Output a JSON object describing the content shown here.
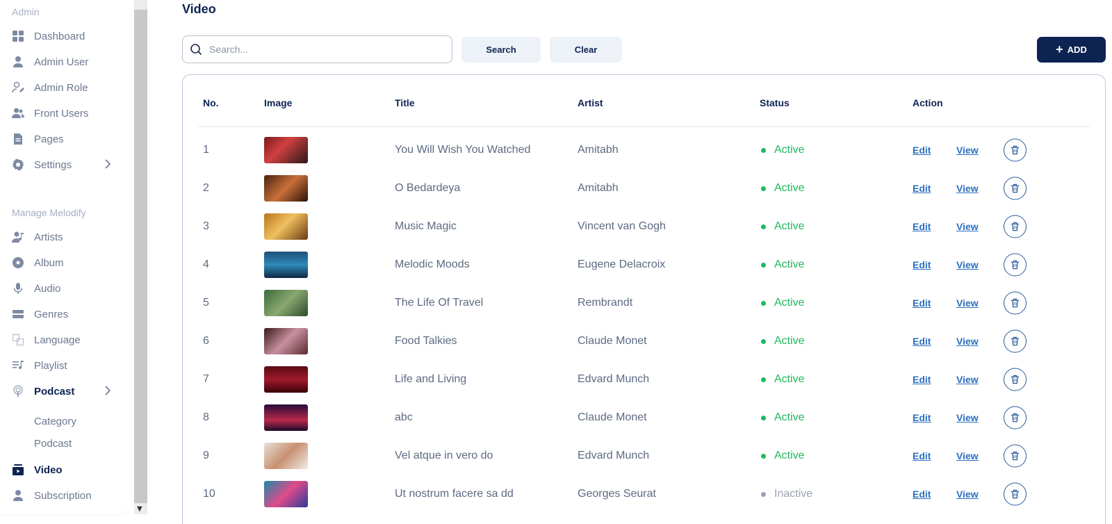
{
  "sidebar": {
    "section_admin": "Admin",
    "admin_items": [
      {
        "label": "Dashboard",
        "icon": "dashboard-icon"
      },
      {
        "label": "Admin User",
        "icon": "user-icon"
      },
      {
        "label": "Admin Role",
        "icon": "user-edit-icon"
      },
      {
        "label": "Front Users",
        "icon": "users-icon"
      },
      {
        "label": "Pages",
        "icon": "page-icon"
      },
      {
        "label": "Settings",
        "icon": "gear-icon"
      }
    ],
    "section_manage": "Manage Melodify",
    "manage_items": [
      {
        "label": "Artists",
        "icon": "artist-icon"
      },
      {
        "label": "Album",
        "icon": "album-icon"
      },
      {
        "label": "Audio",
        "icon": "microphone-icon"
      },
      {
        "label": "Genres",
        "icon": "genres-icon"
      },
      {
        "label": "Language",
        "icon": "language-icon"
      },
      {
        "label": "Playlist",
        "icon": "playlist-icon"
      },
      {
        "label": "Podcast",
        "icon": "podcast-icon"
      }
    ],
    "podcast_sub": [
      "Category",
      "Podcast"
    ],
    "bottom_items": [
      {
        "label": "Video",
        "icon": "video-icon"
      },
      {
        "label": "Subscription",
        "icon": "subscription-icon"
      }
    ]
  },
  "page": {
    "title": "Video"
  },
  "search": {
    "placeholder": "Search...",
    "search_label": "Search",
    "clear_label": "Clear",
    "add_label": "ADD"
  },
  "table": {
    "headers": {
      "no": "No.",
      "image": "Image",
      "title": "Title",
      "artist": "Artist",
      "status": "Status",
      "action": "Action"
    },
    "edit_label": "Edit",
    "view_label": "View",
    "rows": [
      {
        "no": "1",
        "title": "You Will Wish You Watched",
        "artist": "Amitabh",
        "status": "Active"
      },
      {
        "no": "2",
        "title": "O Bedardeya",
        "artist": "Amitabh",
        "status": "Active"
      },
      {
        "no": "3",
        "title": "Music Magic",
        "artist": "Vincent van Gogh",
        "status": "Active"
      },
      {
        "no": "4",
        "title": "Melodic Moods",
        "artist": "Eugene Delacroix",
        "status": "Active"
      },
      {
        "no": "5",
        "title": "The Life Of Travel",
        "artist": "Rembrandt",
        "status": "Active"
      },
      {
        "no": "6",
        "title": "Food Talkies",
        "artist": "Claude Monet",
        "status": "Active"
      },
      {
        "no": "7",
        "title": "Life and Living",
        "artist": "Edvard Munch",
        "status": "Active"
      },
      {
        "no": "8",
        "title": "abc",
        "artist": "Claude Monet",
        "status": "Active"
      },
      {
        "no": "9",
        "title": "Vel atque in vero do",
        "artist": "Edvard Munch",
        "status": "Active"
      },
      {
        "no": "10",
        "title": "Ut nostrum facere sa dd",
        "artist": "Georges Seurat",
        "status": "Inactive"
      }
    ]
  },
  "colors": {
    "primary": "#0d2352",
    "active": "#1fb85c",
    "inactive": "#9aa3b2",
    "link": "#2a6fbf"
  }
}
